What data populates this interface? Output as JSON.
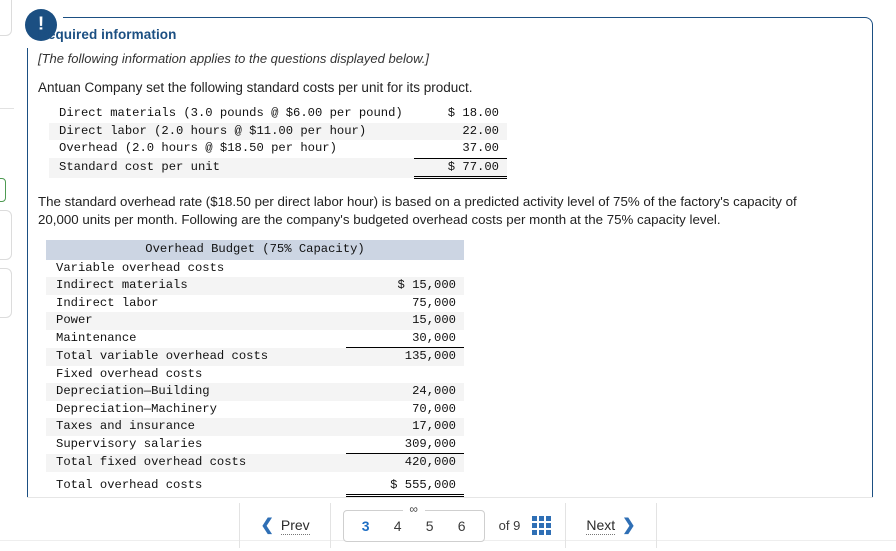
{
  "panel": {
    "badge_icon": "!",
    "title": "Required information",
    "note": "[The following information applies to the questions displayed below.]",
    "lead": "Antuan Company set the following standard costs per unit for its product.",
    "paragraph": "The standard overhead rate ($18.50 per direct labor hour) is based on a predicted activity level of 75% of the factory's capacity of 20,000 units per month. Following are the company's budgeted overhead costs per month at the 75% capacity level."
  },
  "standard_cost_table": {
    "rows": [
      {
        "label": "Direct materials (3.0 pounds @ $6.00 per pound)",
        "value": "$ 18.00"
      },
      {
        "label": "Direct labor (2.0 hours @ $11.00 per hour)",
        "value": "22.00"
      },
      {
        "label": "Overhead (2.0 hours @ $18.50 per hour)",
        "value": "37.00"
      },
      {
        "label": "Standard cost per unit",
        "value": "$ 77.00"
      }
    ]
  },
  "overhead_budget_table": {
    "header": "Overhead Budget (75% Capacity)",
    "rows": [
      {
        "label": "Variable overhead costs",
        "value": ""
      },
      {
        "label": "Indirect materials",
        "value": "$ 15,000"
      },
      {
        "label": "Indirect labor",
        "value": "75,000"
      },
      {
        "label": "Power",
        "value": "15,000"
      },
      {
        "label": "Maintenance",
        "value": "30,000"
      },
      {
        "label": "Total variable overhead costs",
        "value": "135,000"
      },
      {
        "label": "Fixed overhead costs",
        "value": ""
      },
      {
        "label": "Depreciation—Building",
        "value": "24,000"
      },
      {
        "label": "Depreciation—Machinery",
        "value": "70,000"
      },
      {
        "label": "Taxes and insurance",
        "value": "17,000"
      },
      {
        "label": "Supervisory salaries",
        "value": "309,000"
      },
      {
        "label": "Total fixed overhead costs",
        "value": "420,000"
      },
      {
        "label": "Total overhead costs",
        "value": "$ 555,000"
      }
    ]
  },
  "pager": {
    "prev_label": "Prev",
    "next_label": "Next",
    "prev_icon": "❮",
    "next_icon": "❯",
    "link_icon": "∞",
    "pages": [
      "3",
      "4",
      "5",
      "6"
    ],
    "active_page": "3",
    "of_label": "of 9",
    "total_pages": "9",
    "grid_icon": "grid-icon"
  },
  "colors": {
    "panel_border": "#1b4f82",
    "badge_bg": "#1b4f82",
    "title_color": "#1b4f82",
    "table_header_bg": "#ccd5e3",
    "row_alt_bg": "#f4f4f4",
    "accent_blue": "#2f6fb5",
    "active_page": "#1f6fc4"
  }
}
